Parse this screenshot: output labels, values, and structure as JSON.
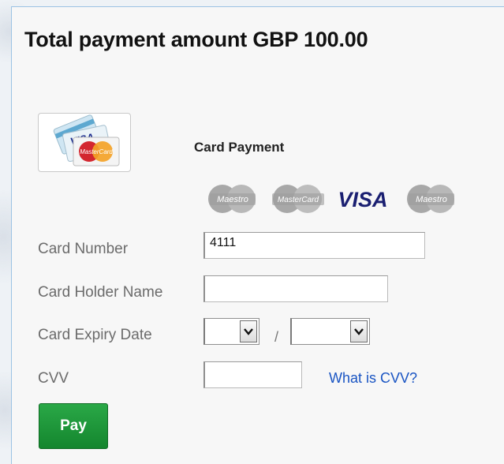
{
  "payment": {
    "total_label": "Total payment amount GBP  100.00"
  },
  "method": {
    "title": "Card Payment",
    "tile_icon": "visa-mastercard-cards-icon",
    "tile_text_visa": "VISA",
    "tile_text_mastercard": "MasterCard"
  },
  "brands": [
    {
      "name": "Maestro",
      "icon": "maestro-icon",
      "color": "#9a9a9a"
    },
    {
      "name": "MasterCard",
      "icon": "mastercard-icon",
      "color": "#9a9a9a"
    },
    {
      "name": "VISA",
      "icon": "visa-icon",
      "color": "#1a1f71"
    },
    {
      "name": "Maestro",
      "icon": "maestro-icon",
      "color": "#9a9a9a"
    }
  ],
  "form": {
    "card_number_label": "Card Number",
    "card_number_value": "4111",
    "card_holder_label": "Card Holder Name",
    "card_holder_value": "",
    "expiry_label": "Card Expiry Date",
    "expiry_separator": "/",
    "expiry_month_value": "",
    "expiry_year_value": "",
    "cvv_label": "CVV",
    "cvv_value": "",
    "cvv_help_link": "What is CVV?"
  },
  "actions": {
    "pay_label": "Pay"
  },
  "colors": {
    "pay_button": "#1b9137",
    "link": "#1a55c3",
    "panel_border": "#9cc3e4"
  }
}
